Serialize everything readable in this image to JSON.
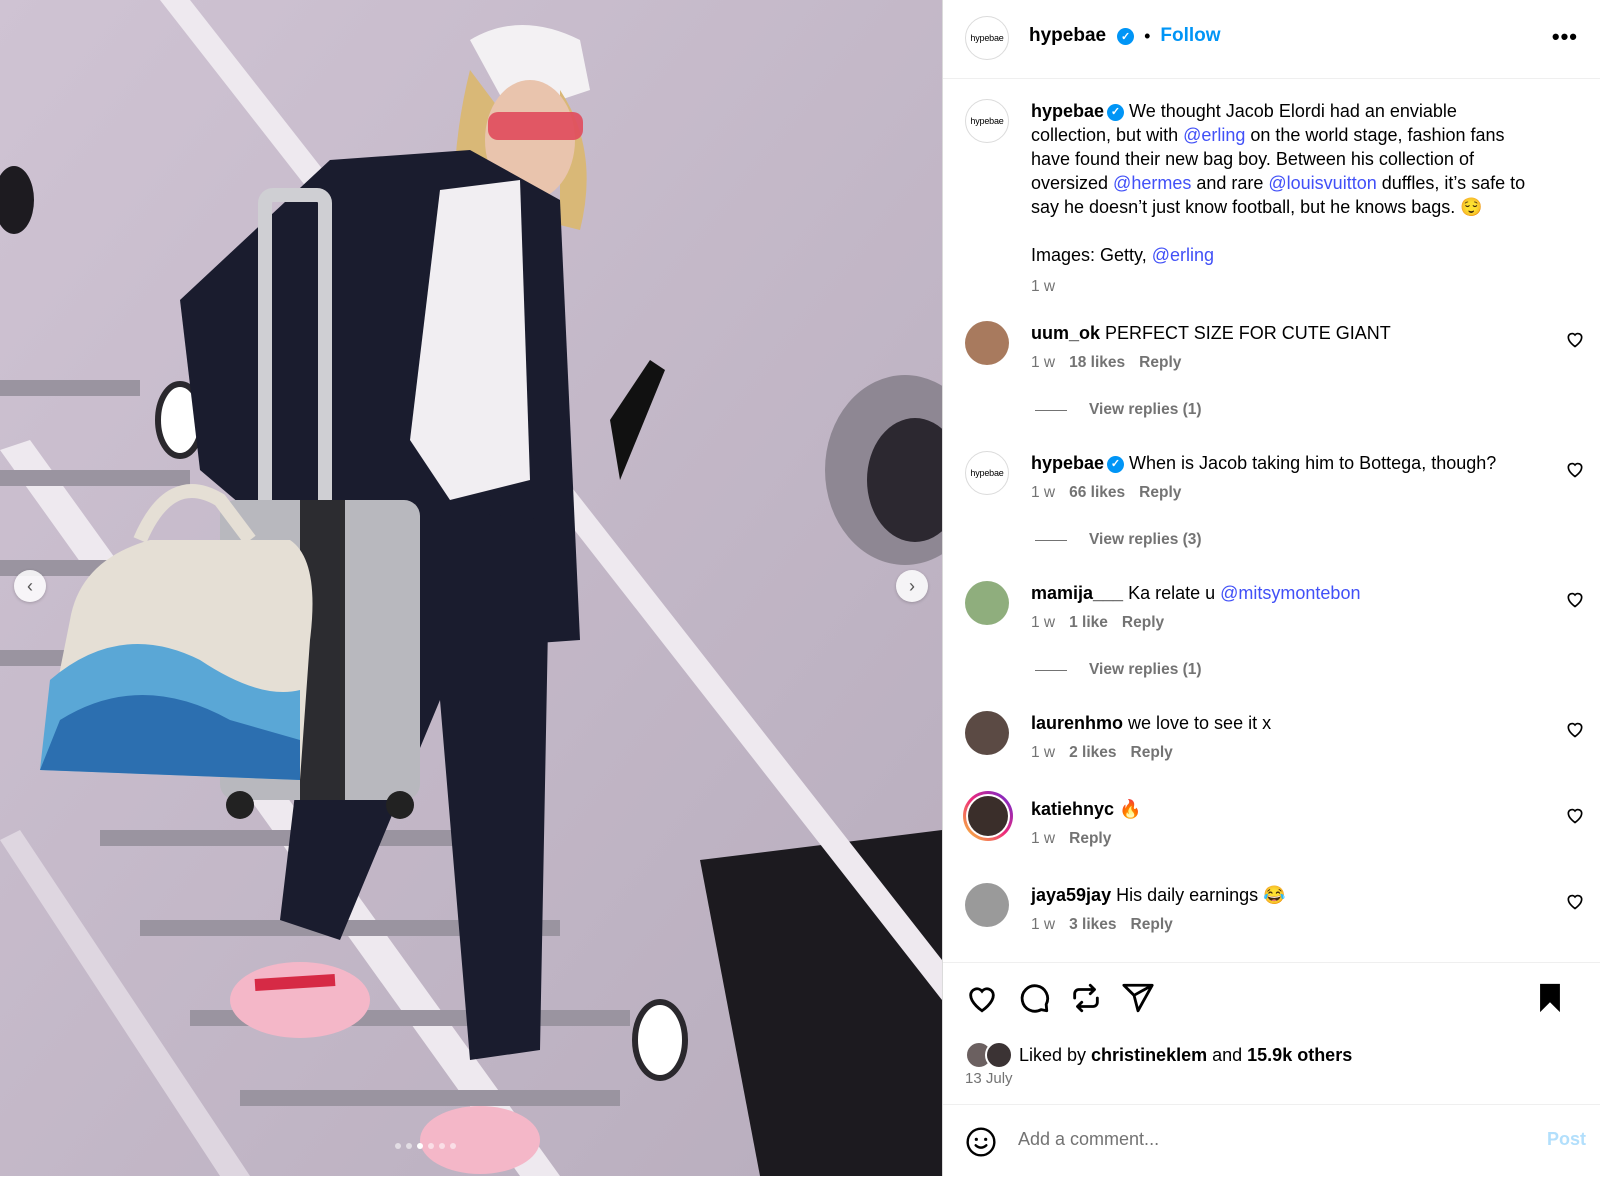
{
  "post": {
    "username": "hypebae",
    "avatar_text": "hypebae",
    "follow_label": "Follow",
    "more_icon": "more-icon",
    "caption": {
      "lines": [
        [
          {
            "t": "We thought Jacob Elordi had an enviable"
          }
        ],
        [
          {
            "t": "collection, but with "
          },
          {
            "t": "@erling",
            "link": true
          },
          {
            "t": " on the world stage, fashion fans"
          }
        ],
        [
          {
            "t": "have found their new bag boy. Between his collection of"
          }
        ],
        [
          {
            "t": "oversized "
          },
          {
            "t": "@hermes",
            "link": true
          },
          {
            "t": " and rare "
          },
          {
            "t": "@louisvuitton",
            "link": true
          },
          {
            "t": " duffles, it’s safe to"
          }
        ],
        [
          {
            "t": "say he doesn’t just know football, but he knows bags. 😌"
          }
        ]
      ],
      "images_prefix": "Images: Getty, ",
      "images_link": "@erling",
      "time": "1 w"
    }
  },
  "comments": [
    {
      "user": "uum_ok",
      "text": "PERFECT SIZE FOR CUTE GIANT",
      "time": "1 w",
      "likes": "18 likes",
      "reply": "Reply",
      "view_replies": "View replies (1)",
      "avatar": "#a87a5e"
    },
    {
      "user": "hypebae",
      "verified": true,
      "text": "When is Jacob taking him to Bottega, though?",
      "time": "1 w",
      "likes": "66 likes",
      "reply": "Reply",
      "view_replies": "View replies (3)",
      "avatar": "logo"
    },
    {
      "user": "mamija___",
      "text": "Ka relate u ",
      "mention": "@mitsymontebon",
      "time": "1 w",
      "likes": "1 like",
      "reply": "Reply",
      "view_replies": "View replies (1)",
      "avatar": "#8fae7d"
    },
    {
      "user": "laurenhmo",
      "text": "we love to see it x",
      "time": "1 w",
      "likes": "2 likes",
      "reply": "Reply",
      "avatar": "#5b4a44"
    },
    {
      "user": "katiehnyc",
      "text": "🔥",
      "time": "1 w",
      "reply": "Reply",
      "avatar": "#3a2e2a",
      "story_ring": true
    },
    {
      "user": "jaya59jay",
      "text": "His daily earnings 😂",
      "time": "1 w",
      "likes": "3 likes",
      "reply": "Reply",
      "avatar": "#9a9a9a"
    }
  ],
  "actions": {
    "icons": [
      "heart-icon",
      "comment-icon",
      "repost-icon",
      "share-icon",
      "bookmark-icon"
    ],
    "liked_by_prefix": "Liked by ",
    "liked_by_user": "christineklem",
    "liked_by_and": " and ",
    "liked_by_others": "15.9k others",
    "date": "13 July"
  },
  "add_comment": {
    "placeholder": "Add a comment...",
    "post_label": "Post",
    "emoji_icon": "emoji-icon"
  },
  "carousel": {
    "dot_count": 6,
    "active_index": 2
  }
}
